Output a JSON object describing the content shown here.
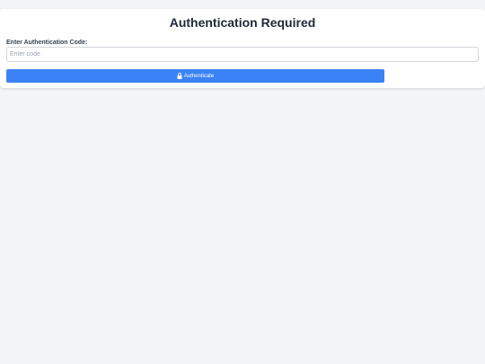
{
  "title": "Authentication Required",
  "form": {
    "label": "Enter Authentication Code:",
    "input_value": "",
    "input_placeholder": "Enter code",
    "button_label": "Authenticate",
    "button_icon": "lock-icon"
  },
  "colors": {
    "background": "#f3f4f6",
    "card": "#ffffff",
    "accent": "#3b82f6",
    "title": "#1f2937"
  }
}
